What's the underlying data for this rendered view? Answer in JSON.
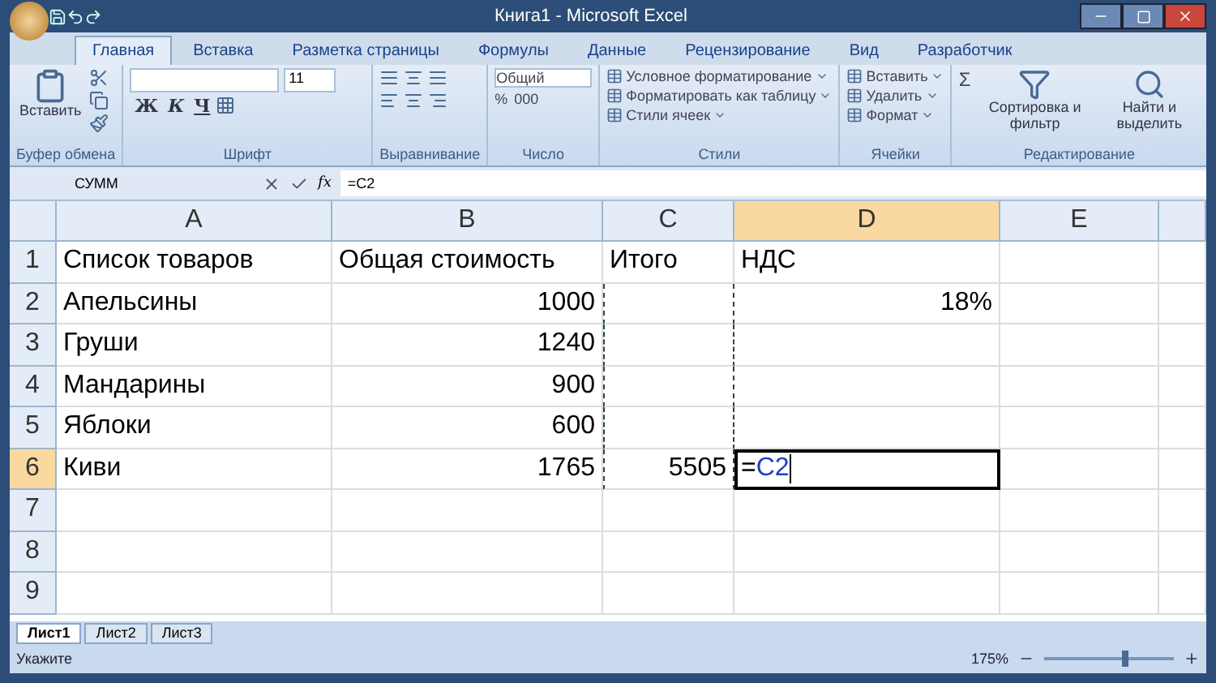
{
  "window": {
    "title": "Книга1 - Microsoft Excel"
  },
  "tabs": [
    {
      "label": "Главная",
      "selected": true
    },
    {
      "label": "Вставка",
      "selected": false
    },
    {
      "label": "Разметка страницы",
      "selected": false
    },
    {
      "label": "Формулы",
      "selected": false
    },
    {
      "label": "Данные",
      "selected": false
    },
    {
      "label": "Рецензирование",
      "selected": false
    },
    {
      "label": "Вид",
      "selected": false
    },
    {
      "label": "Разработчик",
      "selected": false
    }
  ],
  "ribbon": {
    "clipboard": {
      "title": "Буфер обмена",
      "paste": "Вставить"
    },
    "font": {
      "title": "Шрифт",
      "size": "11",
      "bold": "Ж",
      "italic": "К",
      "underline": "Ч"
    },
    "alignment": {
      "title": "Выравнивание"
    },
    "number": {
      "title": "Число",
      "format": "Общий",
      "percent": "%",
      "thousands": "000"
    },
    "styles": {
      "title": "Стили",
      "buttons": [
        "Условное форматирование",
        "Форматировать как таблицу",
        "Стили ячеек"
      ]
    },
    "cells": {
      "title": "Ячейки",
      "buttons": [
        "Вставить",
        "Удалить",
        "Формат"
      ]
    },
    "editing": {
      "title": "Редактирование",
      "sum": "Σ",
      "sort": "Сортировка и фильтр",
      "find": "Найти и выделить"
    }
  },
  "formula_bar": {
    "name_box": "СУММ",
    "function_label": "fx",
    "formula": "=C2"
  },
  "grid": {
    "columns": [
      {
        "label": "A",
        "selected": false,
        "marquee": false
      },
      {
        "label": "B",
        "selected": false,
        "marquee": false
      },
      {
        "label": "C",
        "selected": false,
        "marquee": true
      },
      {
        "label": "D",
        "selected": true,
        "marquee": false
      },
      {
        "label": "E",
        "selected": false,
        "marquee": false
      }
    ],
    "rows": [
      {
        "header": "1",
        "selected": false,
        "marquee": false,
        "cells": [
          {
            "text": "Список товаров",
            "kind": "text"
          },
          {
            "text": "Общая стоимость",
            "kind": "text"
          },
          {
            "text": "Итого",
            "kind": "text"
          },
          {
            "text": "НДС",
            "kind": "text"
          },
          null
        ]
      },
      {
        "header": "2",
        "selected": false,
        "marquee": true,
        "cells": [
          {
            "text": "Апельсины",
            "kind": "text"
          },
          {
            "text": "1000",
            "kind": "number"
          },
          null,
          {
            "text": "18%",
            "kind": "number"
          },
          null
        ]
      },
      {
        "header": "3",
        "selected": false,
        "marquee": true,
        "cells": [
          {
            "text": "Груши",
            "kind": "text"
          },
          {
            "text": "1240",
            "kind": "number"
          },
          null,
          null,
          null
        ]
      },
      {
        "header": "4",
        "selected": false,
        "marquee": true,
        "cells": [
          {
            "text": "Мандарины",
            "kind": "text"
          },
          {
            "text": "900",
            "kind": "number"
          },
          null,
          null,
          null
        ]
      },
      {
        "header": "5",
        "selected": false,
        "marquee": true,
        "cells": [
          {
            "text": "Яблоки",
            "kind": "text"
          },
          {
            "text": "600",
            "kind": "number"
          },
          null,
          null,
          null
        ]
      },
      {
        "header": "6",
        "selected": true,
        "marquee": true,
        "cells": [
          {
            "text": "Киви",
            "kind": "text"
          },
          {
            "text": "1765",
            "kind": "number"
          },
          {
            "text": "5505",
            "kind": "number"
          },
          {
            "kind": "editing",
            "prefix": "=",
            "ref": "C2"
          },
          null
        ]
      },
      {
        "header": "7",
        "selected": false,
        "marquee": false,
        "cells": [
          null,
          null,
          null,
          null,
          null
        ]
      },
      {
        "header": "8",
        "selected": false,
        "marquee": false,
        "cells": [
          null,
          null,
          null,
          null,
          null
        ]
      },
      {
        "header": "9",
        "selected": false,
        "marquee": false,
        "cells": [
          null,
          null,
          null,
          null,
          null
        ]
      }
    ]
  },
  "sheet_tabs": [
    {
      "label": "Лист1",
      "selected": true
    },
    {
      "label": "Лист2",
      "selected": false
    },
    {
      "label": "Лист3",
      "selected": false
    }
  ],
  "status_bar": {
    "mode": "Укажите",
    "zoom": "175%",
    "zoom_level": {
      "level": 0.6
    }
  }
}
